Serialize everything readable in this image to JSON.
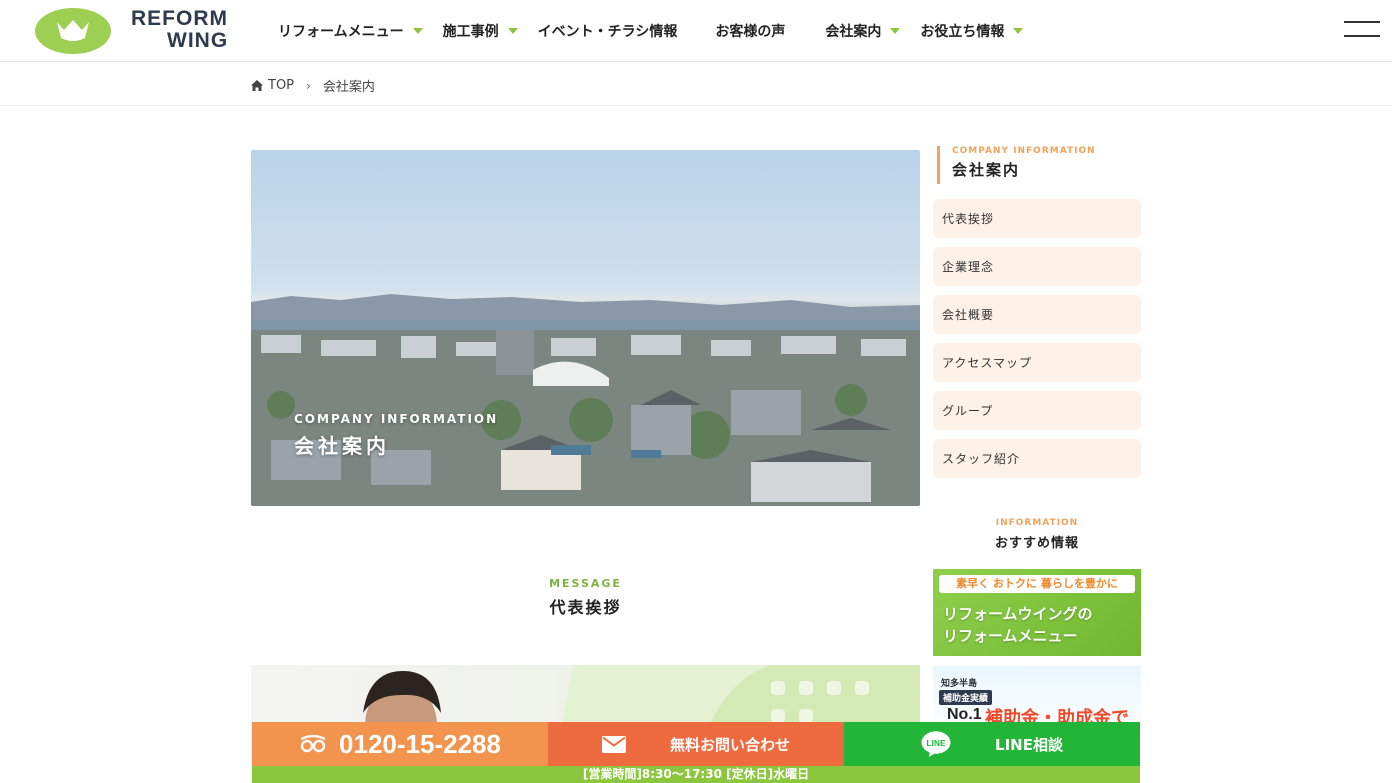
{
  "header": {
    "logo_line1": "REFORM",
    "logo_line2": "WING",
    "nav": [
      {
        "label": "リフォームメニュー",
        "has_submenu": true
      },
      {
        "label": "施工事例",
        "has_submenu": true
      },
      {
        "label": "イベント・チラシ情報",
        "has_submenu": false
      },
      {
        "label": "お客様の声",
        "has_submenu": false
      },
      {
        "label": "会社案内",
        "has_submenu": true
      },
      {
        "label": "お役立ち情報",
        "has_submenu": true
      }
    ]
  },
  "breadcrumb": {
    "home": "TOP",
    "separator": "›",
    "current": "会社案内"
  },
  "hero": {
    "en": "COMPANY INFORMATION",
    "ja": "会社案内"
  },
  "message": {
    "en": "MESSAGE",
    "ja": "代表挨拶"
  },
  "sidebar": {
    "en": "COMPANY INFORMATION",
    "ja": "会社案内",
    "items": [
      "代表挨拶",
      "企業理念",
      "会社概要",
      "アクセスマップ",
      "グループ",
      "スタッフ紹介"
    ],
    "info_en": "INFORMATION",
    "info_ja": "おすすめ情報",
    "banner1_top": "素早く おトクに 暮らしを豊かに",
    "banner1_line1": "リフォームウイングの",
    "banner1_line2": "リフォームメニュー",
    "banner2_small1": "知多半島",
    "banner2_small2": "補助金実績",
    "banner2_no1": "No.1",
    "banner2_main": "補助金・助成金で"
  },
  "cta": {
    "phone": "0120-15-2288",
    "mail": "無料お問い合わせ",
    "line": "LINE相談",
    "line_icon_text": "LINE",
    "hours": "[営業時間]8:30～17:30 [定休日]水曜日"
  },
  "colors": {
    "accent_green": "#8cc63f",
    "accent_orange": "#f0a25a",
    "phone_bg": "#f2934e",
    "mail_bg": "#ee6a3f",
    "line_bg": "#22b538"
  }
}
